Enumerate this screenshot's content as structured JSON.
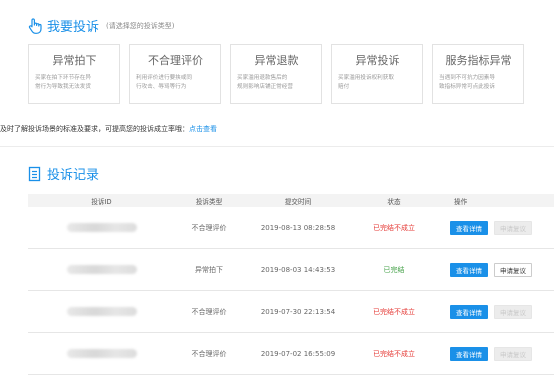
{
  "complaint_section": {
    "title": "我要投诉",
    "subtitle": "(请选择您的投诉类型)",
    "icon": "hand-pointer-icon",
    "accent": "#1a90e8",
    "cards": [
      {
        "title": "异常拍下",
        "desc1": "买家在拍下环节存在异",
        "desc2": "常行为导致我无法发货"
      },
      {
        "title": "不合理评价",
        "desc1": "利用评价进行要挟或同",
        "desc2": "行攻击、辱骂等行为"
      },
      {
        "title": "异常退款",
        "desc1": "买家滥用退款售后的",
        "desc2": "规则影响店铺正常经营"
      },
      {
        "title": "异常投诉",
        "desc1": "买家滥用投诉权利获取",
        "desc2": "赔付"
      },
      {
        "title": "服务指标异常",
        "desc1": "当遇到不可抗力因素导",
        "desc2": "致指标异常可点此投诉"
      }
    ],
    "notice_text": "及时了解投诉场景的标准及要求，可提高您的投诉成立率哦：",
    "notice_link": "点击查看"
  },
  "records_section": {
    "title": "投诉记录",
    "icon": "document-list-icon",
    "columns": [
      "投诉ID",
      "投诉类型",
      "提交时间",
      "状态",
      "操作"
    ],
    "rows": [
      {
        "type": "不合理评价",
        "time": "2019-08-13 08:28:58",
        "status": "已完结不成立",
        "status_color": "#e53935",
        "detail_label": "查看详情",
        "appeal_label": "申请复议",
        "appeal_enabled": false
      },
      {
        "type": "异常拍下",
        "time": "2019-08-03 14:43:53",
        "status": "已完结",
        "status_color": "#43a047",
        "detail_label": "查看详情",
        "appeal_label": "申请复议",
        "appeal_enabled": true
      },
      {
        "type": "不合理评价",
        "time": "2019-07-30 22:13:54",
        "status": "已完结不成立",
        "status_color": "#e53935",
        "detail_label": "查看详情",
        "appeal_label": "申请复议",
        "appeal_enabled": false
      },
      {
        "type": "不合理评价",
        "time": "2019-07-02 16:55:09",
        "status": "已完结不成立",
        "status_color": "#e53935",
        "detail_label": "查看详情",
        "appeal_label": "申请复议",
        "appeal_enabled": false
      }
    ]
  }
}
